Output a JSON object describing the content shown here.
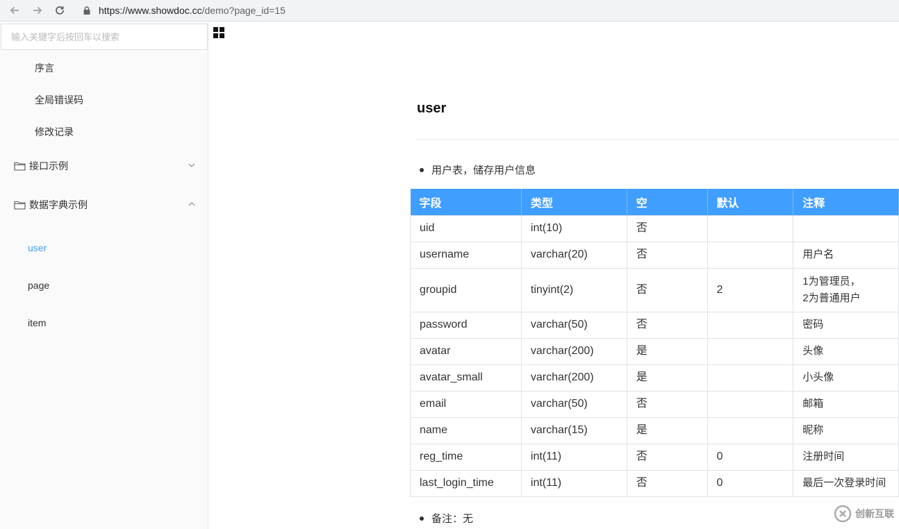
{
  "browser": {
    "url_host": "https://www.showdoc.cc",
    "url_path": "/demo?page_id=15"
  },
  "sidebar": {
    "search_placeholder": "输入关键字后按回车以搜索",
    "top_links": [
      "序言",
      "全局错误码",
      "修改记录"
    ],
    "folders": [
      {
        "label": "接口示例",
        "expanded": false
      },
      {
        "label": "数据字典示例",
        "expanded": true
      }
    ],
    "sub_links": [
      "user",
      "page",
      "item"
    ],
    "active_item": "user"
  },
  "content": {
    "title": "user",
    "description": "用户表，储存用户信息",
    "table": {
      "headers": [
        "字段",
        "类型",
        "空",
        "默认",
        "注释"
      ],
      "rows": [
        [
          "uid",
          "int(10)",
          "否",
          "",
          ""
        ],
        [
          "username",
          "varchar(20)",
          "否",
          "",
          "用户名"
        ],
        [
          "groupid",
          "tinyint(2)",
          "否",
          "2",
          "1为管理员，\n2为普通用户"
        ],
        [
          "password",
          "varchar(50)",
          "否",
          "",
          "密码"
        ],
        [
          "avatar",
          "varchar(200)",
          "是",
          "",
          "头像"
        ],
        [
          "avatar_small",
          "varchar(200)",
          "是",
          "",
          "小头像"
        ],
        [
          "email",
          "varchar(50)",
          "否",
          "",
          "邮箱"
        ],
        [
          "name",
          "varchar(15)",
          "是",
          "",
          "昵称"
        ],
        [
          "reg_time",
          "int(11)",
          "否",
          "0",
          "注册时间"
        ],
        [
          "last_login_time",
          "int(11)",
          "否",
          "0",
          "最后一次登录时间"
        ]
      ]
    },
    "remark": "备注：无"
  },
  "watermark": {
    "text": "创新互联"
  },
  "colors": {
    "accent": "#409eff",
    "header_bg": "#409eff"
  }
}
